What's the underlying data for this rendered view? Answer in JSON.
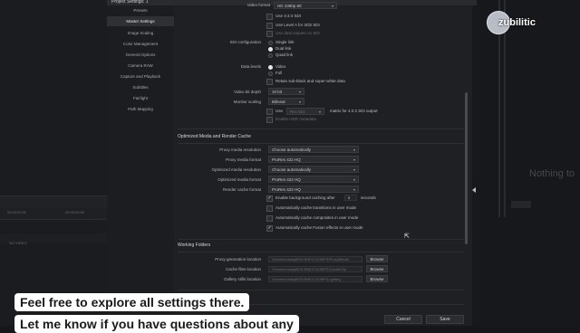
{
  "window": {
    "title": "Project Settings:  1"
  },
  "nav": {
    "items": [
      {
        "label": "Presets",
        "active": false
      },
      {
        "label": "Master Settings",
        "active": true
      },
      {
        "label": "Image Scaling",
        "active": false
      },
      {
        "label": "Color Management",
        "active": false
      },
      {
        "label": "General Options",
        "active": false
      },
      {
        "label": "Camera RAW",
        "active": false
      },
      {
        "label": "Capture and Playback",
        "active": false
      },
      {
        "label": "Subtitles",
        "active": false
      },
      {
        "label": "Fairlight",
        "active": false
      },
      {
        "label": "Path Mapping",
        "active": false
      }
    ]
  },
  "video_format": {
    "label": "Video format",
    "value": "HD 1080p 60"
  },
  "top_options": [
    "Use 4:4:4 SDI",
    "Use Level A for 3Gb SDI",
    "Use dual outputs on SDI"
  ],
  "sdi_config": {
    "label": "SDI configuration",
    "options": [
      "Single link",
      "Dual link",
      "Quad link"
    ],
    "selected": "Dual link"
  },
  "data_levels": {
    "label": "Data levels",
    "options": [
      "Video",
      "Full"
    ],
    "selected": "Video",
    "retain": "Retain sub-black and super-white data"
  },
  "video_bit_depth": {
    "label": "Video bit depth",
    "value": "10 bit"
  },
  "monitor_scaling": {
    "label": "Monitor scaling",
    "value": "Bilinear"
  },
  "use_row": {
    "use": "Use",
    "rec": "Rec.601",
    "matrix": "matrix for 4:2:2 SDI output"
  },
  "hdr_metadata": "Enable HDR metadata",
  "omrc": {
    "title": "Optimized Media and Render Cache",
    "rows": [
      {
        "label": "Proxy media resolution",
        "value": "Choose automatically"
      },
      {
        "label": "Proxy media format",
        "value": "ProRes 422 HQ"
      },
      {
        "label": "Optimized media resolution",
        "value": "Choose automatically"
      },
      {
        "label": "Optimized media format",
        "value": "ProRes 422 HQ"
      },
      {
        "label": "Render cache format",
        "value": "ProRes 422 HQ"
      }
    ],
    "bg_caching": {
      "label": "Enable background caching after",
      "value": "5",
      "unit": "seconds"
    },
    "checks": [
      {
        "label": "Automatically cache transitions in user mode",
        "checked": false
      },
      {
        "label": "Automatically cache composites in user mode",
        "checked": false
      },
      {
        "label": "Automatically cache Fusion effects in user mode",
        "checked": true
      }
    ]
  },
  "working_folders": {
    "title": "Working Folders",
    "rows": [
      {
        "label": "Proxy generation location",
        "path": "/Volumes/easyBOX/SNEO DUMPS/ProxyMedia",
        "button": "Browse"
      },
      {
        "label": "Cache files location",
        "path": "/Volumes/easyBOX/SNEO DUMPS/CacheClip",
        "button": "Browse"
      },
      {
        "label": "Gallery stills location",
        "path": "/Volumes/easyBOX/SNEO DUMPS/.gallery",
        "button": "Browse"
      }
    ]
  },
  "footer": {
    "cancel": "Cancel",
    "save": "Save"
  },
  "captions": {
    "line1": "Feel free to explore all settings there.",
    "line2": "Let me know if you have questions about any"
  },
  "background": {
    "viewer_text": "Nothing to",
    "logo_text": "zubilitic",
    "left_label": "NO VIDEO",
    "left_small": [
      "00:00:00:00",
      "00:00:00:00"
    ]
  },
  "colors": {
    "accent": "#e6e6e6",
    "panel": "#1f2023",
    "nav": "#1c1d20"
  }
}
